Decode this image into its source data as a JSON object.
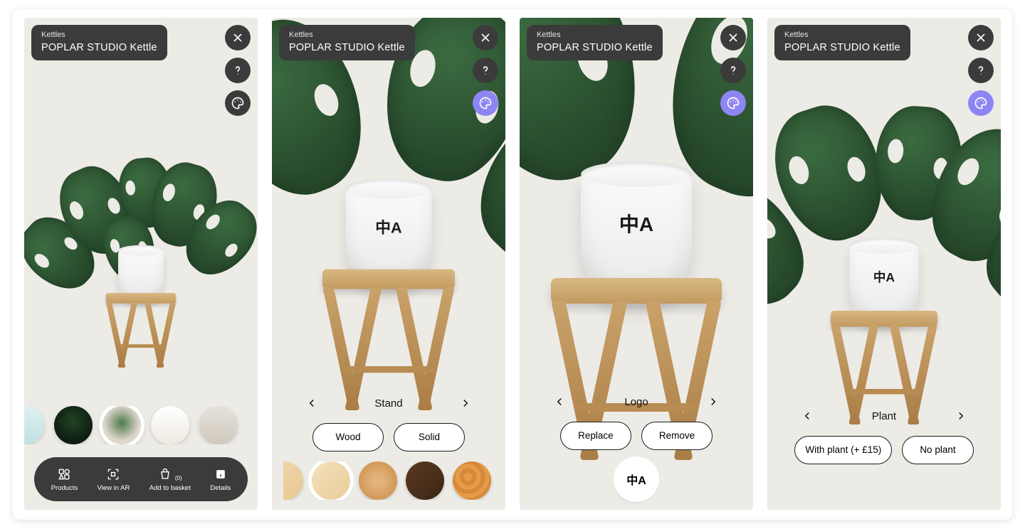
{
  "breadcrumb": "Kettles",
  "product_title": "POPLAR STUDIO  Kettle",
  "icons": {
    "close": "close-icon",
    "help": "help-icon",
    "palette_dark": "palette-icon",
    "palette_active": "palette-icon"
  },
  "colors": {
    "accent_purple": "#8e85f4",
    "panel_dark": "#3b3b3b"
  },
  "screen1": {
    "action_bar": [
      {
        "id": "products",
        "label": "Products"
      },
      {
        "id": "view_ar",
        "label": "View in AR"
      },
      {
        "id": "basket",
        "label": "Add to basket",
        "count_suffix": "(0)"
      },
      {
        "id": "details",
        "label": "Details"
      }
    ],
    "thumb_count": 6,
    "thumb_active_index": 2
  },
  "screen2": {
    "picker_title": "Stand",
    "options": [
      "Wood",
      "Solid"
    ],
    "swatches": [
      {
        "bg": "linear-gradient(135deg,#f0d8b0,#e7c892)"
      },
      {
        "bg": "linear-gradient(135deg,#f4e1bd,#eacd98)",
        "selected": true
      },
      {
        "bg": "radial-gradient(circle,#e2b27a 20%,#cf9350 80%)"
      },
      {
        "bg": "linear-gradient(135deg,#5a3a22,#3b2514)"
      },
      {
        "bg": "repeating-radial-gradient(circle at 40% 40%,#e79b45 0 6px,#d5893a 6px 12px)"
      },
      {
        "bg": "linear-gradient(135deg,#d9a86d,#c28a4c)"
      }
    ]
  },
  "screen3": {
    "picker_title": "Logo",
    "options": [
      "Replace",
      "Remove"
    ],
    "logo_glyph": "中\nA"
  },
  "screen4": {
    "picker_title": "Plant",
    "options": [
      "With plant (+ £15)",
      "No plant"
    ]
  }
}
